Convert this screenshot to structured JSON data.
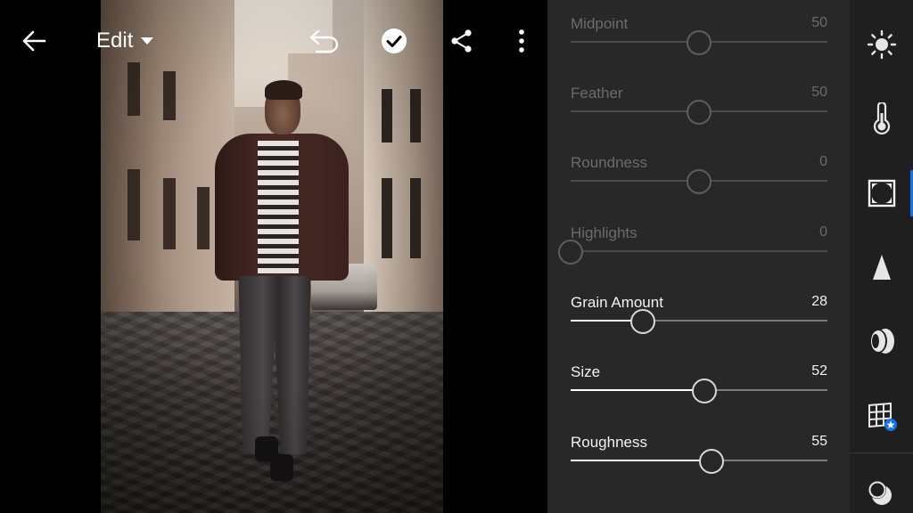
{
  "toolbar": {
    "edit_label": "Edit",
    "icons": [
      "back-arrow-icon",
      "dropdown-caret-icon",
      "undo-icon",
      "checkmark-icon",
      "share-icon",
      "more-vertical-icon"
    ]
  },
  "panel": {
    "sliders": [
      {
        "id": "midpoint",
        "label": "Midpoint",
        "value": "50",
        "fraction": 0.5,
        "enabled": false,
        "bipolar": false
      },
      {
        "id": "feather",
        "label": "Feather",
        "value": "50",
        "fraction": 0.5,
        "enabled": false,
        "bipolar": false
      },
      {
        "id": "roundness",
        "label": "Roundness",
        "value": "0",
        "fraction": 0.5,
        "enabled": false,
        "bipolar": true
      },
      {
        "id": "highlights",
        "label": "Highlights",
        "value": "0",
        "fraction": 0.0,
        "enabled": false,
        "bipolar": false
      },
      {
        "id": "grain-amount",
        "label": "Grain Amount",
        "value": "28",
        "fraction": 0.28,
        "enabled": true,
        "bipolar": false
      },
      {
        "id": "size",
        "label": "Size",
        "value": "52",
        "fraction": 0.52,
        "enabled": true,
        "bipolar": false
      },
      {
        "id": "roughness",
        "label": "Roughness",
        "value": "55",
        "fraction": 0.55,
        "enabled": true,
        "bipolar": false
      }
    ]
  },
  "rail": {
    "items": [
      {
        "icon": "light-icon",
        "active": false
      },
      {
        "icon": "color-icon",
        "active": false
      },
      {
        "icon": "effects-icon",
        "active": true
      },
      {
        "icon": "detail-icon",
        "active": false
      },
      {
        "icon": "optics-icon",
        "active": false
      },
      {
        "icon": "geometry-icon",
        "active": false
      },
      {
        "icon": "presets-icon",
        "active": false
      }
    ]
  },
  "colors": {
    "panel_bg": "#282828",
    "rail_bg": "#1f1f1f",
    "accent": "#1473e6",
    "disabled_text": "#6b6b6b",
    "enabled_text": "#f2f2f2"
  }
}
